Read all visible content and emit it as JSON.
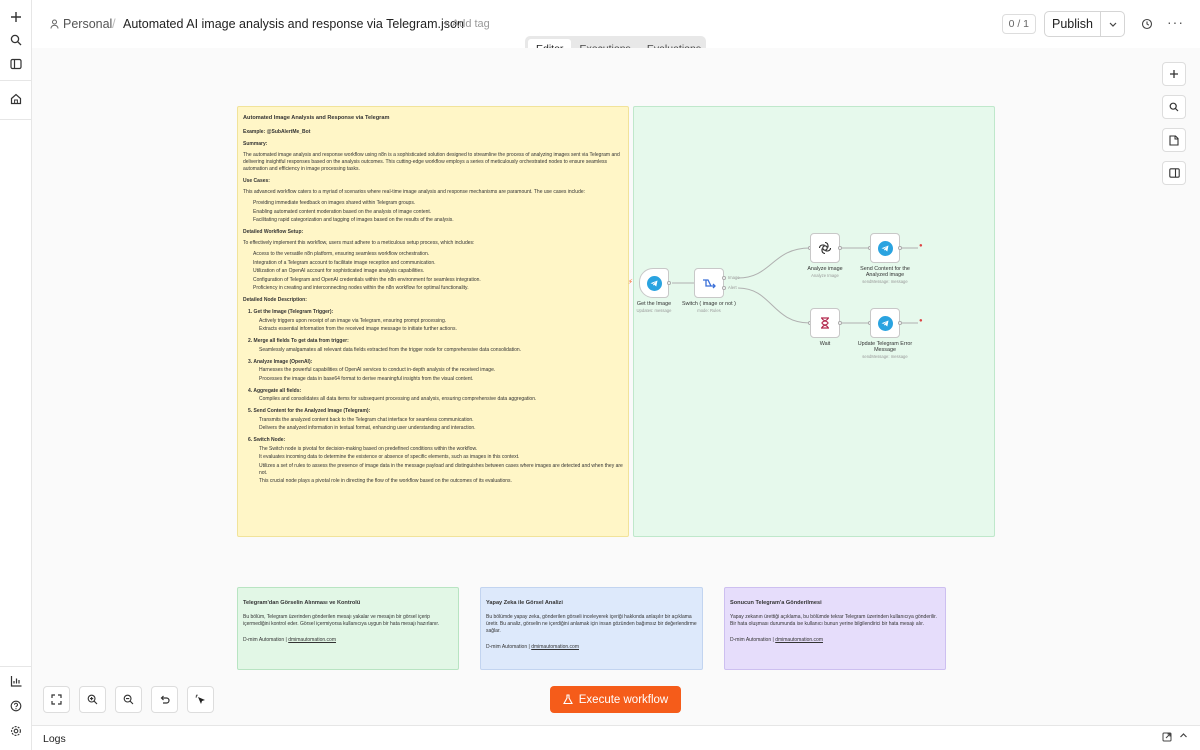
{
  "sidebar": {
    "icons": [
      "plus-icon",
      "search-icon",
      "panel-icon",
      "home-icon",
      "chart-icon",
      "help-icon",
      "settings-icon"
    ]
  },
  "header": {
    "project": "Personal",
    "workflow_title": "Automated AI image analysis and response via Telegram.json",
    "add_tag": "+ Add tag",
    "counter": "0 / 1",
    "publish_label": "Publish"
  },
  "tabs": [
    {
      "label": "Editor",
      "active": true
    },
    {
      "label": "Executions",
      "active": false
    },
    {
      "label": "Evaluations",
      "active": false
    }
  ],
  "main_note": {
    "title": "Automated Image Analysis and Response via Telegram",
    "example": "Example: @SubAlertMe_Bot",
    "summary_h": "Summary:",
    "summary": "The automated image analysis and response workflow using n8n is a sophisticated solution designed to streamline the process of analyzing images sent via Telegram and delivering insightful responses based on the analysis outcomes. This cutting-edge workflow employs a series of meticulously orchestrated nodes to ensure seamless automation and efficiency in image processing tasks.",
    "usecases_h": "Use Cases:",
    "usecases": "This advanced workflow caters to a myriad of scenarios where real-time image analysis and response mechanisms are paramount. The use cases include:",
    "usecase_items": [
      "Providing immediate feedback on images shared within Telegram groups.",
      "Enabling automated content moderation based on the analysis of image content.",
      "Facilitating rapid categorization and tagging of images based on the results of the analysis."
    ],
    "setup_h": "Detailed Workflow Setup:",
    "setup": "To effectively implement this workflow, users must adhere to a meticulous setup process, which includes:",
    "setup_items": [
      "Access to the versatile n8n platform, ensuring seamless workflow orchestration.",
      "Integration of a Telegram account to facilitate image reception and communication.",
      "Utilization of an OpenAI account for sophisticated image analysis capabilities.",
      "Configuration of Telegram and OpenAI credentials within the n8n environment for seamless integration.",
      "Proficiency in creating and interconnecting nodes within the n8n workflow for optimal functionality."
    ],
    "desc_h": "Detailed Node Description:",
    "desc_items": [
      {
        "h": "1. Get the Image (Telegram Trigger):",
        "lines": [
          "Actively triggers upon receipt of an image via Telegram, ensuring prompt processing.",
          "Extracts essential information from the received image message to initiate further actions."
        ]
      },
      {
        "h": "2. Merge all fields To get data from trigger:",
        "lines": [
          "Seamlessly amalgamates all relevant data fields extracted from the trigger node for comprehensive data consolidation."
        ]
      },
      {
        "h": "3. Analyze Image (OpenAI):",
        "lines": [
          "Harnesses the powerful capabilities of OpenAI services to conduct in-depth analysis of the received image.",
          "Processes the image data in base64 format to derive meaningful insights from the visual content."
        ]
      },
      {
        "h": "4. Aggregate all fields:",
        "lines": [
          "Compiles and consolidates all data items for subsequent processing and analysis, ensuring comprehensive data aggregation."
        ]
      },
      {
        "h": "5. Send Content for the Analyzed Image (Telegram):",
        "lines": [
          "Transmits the analyzed content back to the Telegram chat interface for seamless communication.",
          "Delivers the analyzed information in textual format, enhancing user understanding and interaction."
        ]
      },
      {
        "h": "6. Switch Node:",
        "lines": [
          "The Switch node is pivotal for decision-making based on predefined conditions within the workflow.",
          "It evaluates incoming data to determine the existence or absence of specific elements, such as images in this context.",
          "Utilizes a set of rules to assess the presence of image data in the message payload and distinguishes between cases where images are detected and when they are not.",
          "This crucial node plays a pivotal role in directing the flow of the workflow based on the outcomes of its evaluations."
        ]
      }
    ]
  },
  "nodes": {
    "get_image": {
      "label": "Get the Image",
      "sub": "Updates: message"
    },
    "switch": {
      "label": "Switch ( image or not )",
      "sub": "mode: Rules",
      "out1": "Image",
      "out2": "Alert"
    },
    "analyze": {
      "label": "Analyze image",
      "sub": "Analyze Image"
    },
    "send": {
      "label": "Send Content for the Analyzed image",
      "sub": "sendMessage: message"
    },
    "wait": {
      "label": "Wait",
      "sub": ""
    },
    "update": {
      "label": "Update Telegram Error Message",
      "sub": "sendMessage: message"
    }
  },
  "bottom_notes": [
    {
      "title": "Telegram'dan Görselin Alınması ve Kontrolü",
      "body": "Bu bölüm, Telegram üzerinden gönderilen mesajı yakalar ve mesajın bir görsel içerip içermediğini kontrol eder. Görsel içermiyorsa kullanıcıya uygun bir hata mesajı hazırlanır.",
      "footer": "D-mim Automation |",
      "link": "dmimautomation.com"
    },
    {
      "title": "Yapay Zeka ile Görsel Analizi",
      "body": "Bu bölümde yapay zeka, gönderilen görseli inceleyerek içeriği hakkında anlaşılır bir açıklama üretir. Bu analiz, görselin ne içerdiğini anlamak için insan gözünden bağımsız bir değerlendirme sağlar.",
      "footer": "D-mim Automation |",
      "link": "dmimautomation.com"
    },
    {
      "title": "Sonucun Telegram'a Gönderilmesi",
      "body": "Yapay zekanın ürettiği açıklama, bu bölümde tekrar Telegram üzerinden kullanıcıya gönderilir. Bir hata oluşması durumunda ise kullanıcı bunun yerine bilgilendirici bir hata mesajı alır.",
      "footer": "D-mim Automation |",
      "link": "dmimautomation.com"
    }
  ],
  "execute_label": "Execute workflow",
  "logs_label": "Logs",
  "colors": {
    "accent": "#f55c1a",
    "telegram": "#2aa3e0",
    "wait": "#b3294e"
  }
}
